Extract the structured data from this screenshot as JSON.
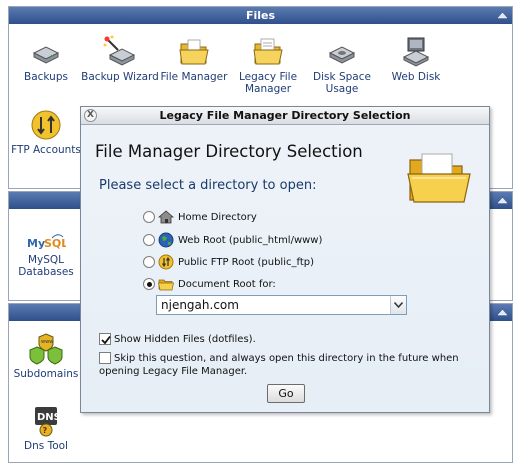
{
  "panels": {
    "files": {
      "title": "Files",
      "apps": [
        {
          "label": "Backups",
          "icon": "backups-icon"
        },
        {
          "label": "Backup Wizard",
          "icon": "backup-wizard-icon"
        },
        {
          "label": "File Manager",
          "icon": "file-manager-icon"
        },
        {
          "label": "Legacy File Manager",
          "icon": "legacy-file-manager-icon"
        },
        {
          "label": "Disk Space Usage",
          "icon": "disk-space-usage-icon"
        },
        {
          "label": "Web Disk",
          "icon": "web-disk-icon"
        },
        {
          "label": "FTP Accounts",
          "icon": "ftp-accounts-icon"
        }
      ]
    },
    "databases": {
      "apps": [
        {
          "label": "MySQL Databases",
          "icon": "mysql-icon"
        }
      ]
    },
    "domains": {
      "apps": [
        {
          "label": "Subdomains",
          "icon": "subdomains-icon"
        },
        {
          "label": "Dns Tool",
          "icon": "dns-tool-icon"
        }
      ]
    }
  },
  "dialog": {
    "window_title": "Legacy File Manager Directory Selection",
    "close_glyph": "X",
    "heading": "File Manager Directory Selection",
    "prompt": "Please select a directory to open:",
    "options": [
      {
        "label": "Home Directory",
        "icon": "home-icon",
        "selected": false
      },
      {
        "label": "Web Root (public_html/www)",
        "icon": "globe-icon",
        "selected": false
      },
      {
        "label": "Public FTP Root (public_ftp)",
        "icon": "ftp-icon",
        "selected": false
      },
      {
        "label": "Document Root for:",
        "icon": "folder-icon",
        "selected": true
      }
    ],
    "document_root_select": {
      "value": "njengah.com"
    },
    "show_hidden": {
      "label": "Show Hidden Files (dotfiles).",
      "checked": true
    },
    "skip_question": {
      "label": "Skip this question, and always open this directory in the future when opening Legacy File Manager.",
      "checked": false
    },
    "go_button": "Go"
  },
  "colors": {
    "header_blue": "#2e4f8a",
    "link_blue": "#1f3d78",
    "dialog_bg": "#e9f0f7"
  }
}
